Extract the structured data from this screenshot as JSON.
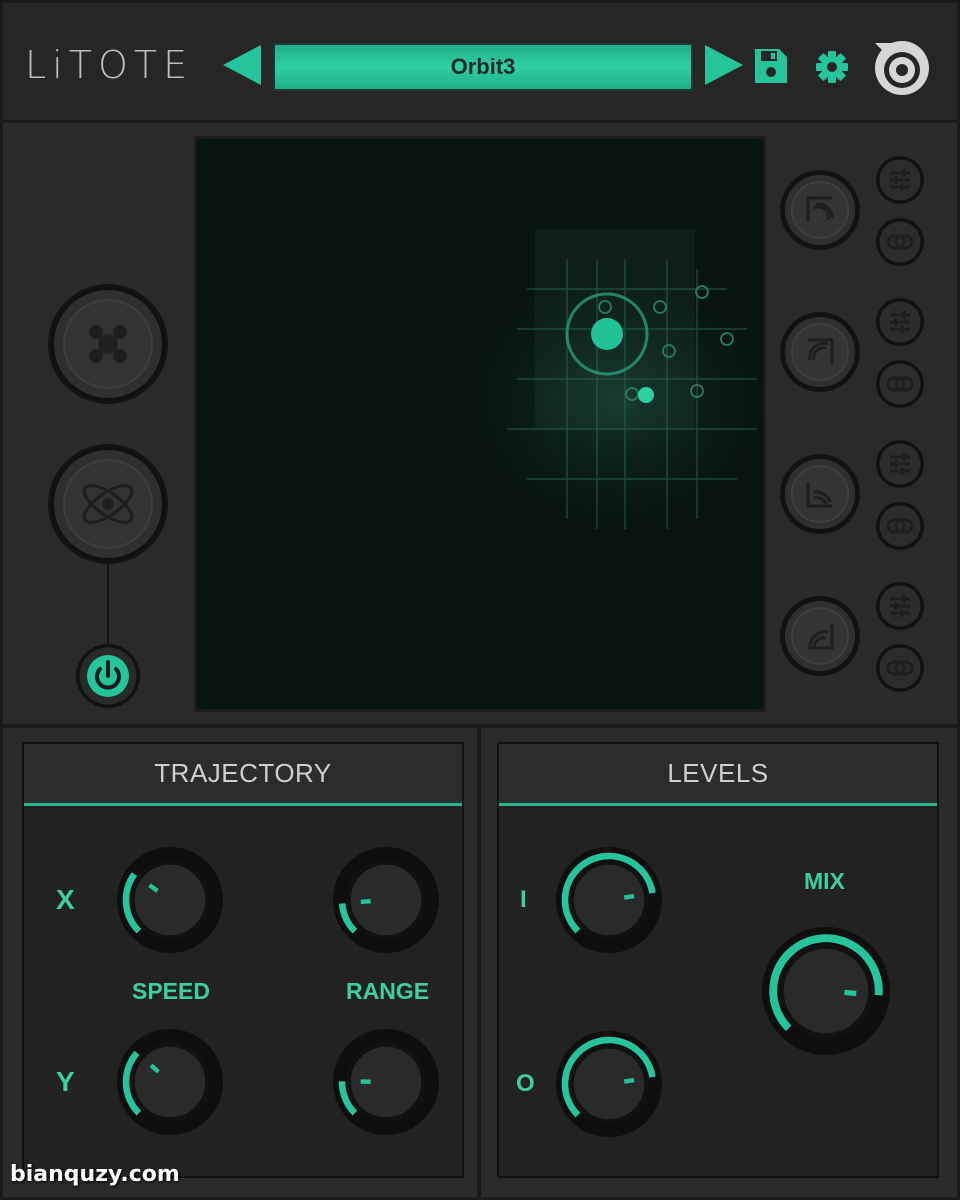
{
  "header": {
    "logo_text": "LiTOTE",
    "preset_name": "Orbit3"
  },
  "icons": {
    "prev": "triangle-left-icon",
    "next": "triangle-right-icon",
    "save": "floppy-disk-icon",
    "settings": "gear-icon",
    "brand": "brand-logo-icon",
    "power": "power-icon"
  },
  "colors": {
    "accent": "#25c49a",
    "pad_bg": "#081411",
    "panel_bg": "#222222"
  },
  "trajectory": {
    "title": "TRAJECTORY",
    "x_label": "X",
    "y_label": "Y",
    "speed_label": "SPEED",
    "range_label": "RANGE",
    "knobs": {
      "speed_x": 0.3,
      "range_x": 0.15,
      "speed_y": 0.32,
      "range_y": 0.17
    }
  },
  "levels": {
    "title": "LEVELS",
    "i_label": "I",
    "o_label": "O",
    "mix_label": "MIX",
    "knobs": {
      "input": 0.8,
      "output": 0.8,
      "mix": 0.85
    }
  },
  "watermark": "bianquzy.com"
}
